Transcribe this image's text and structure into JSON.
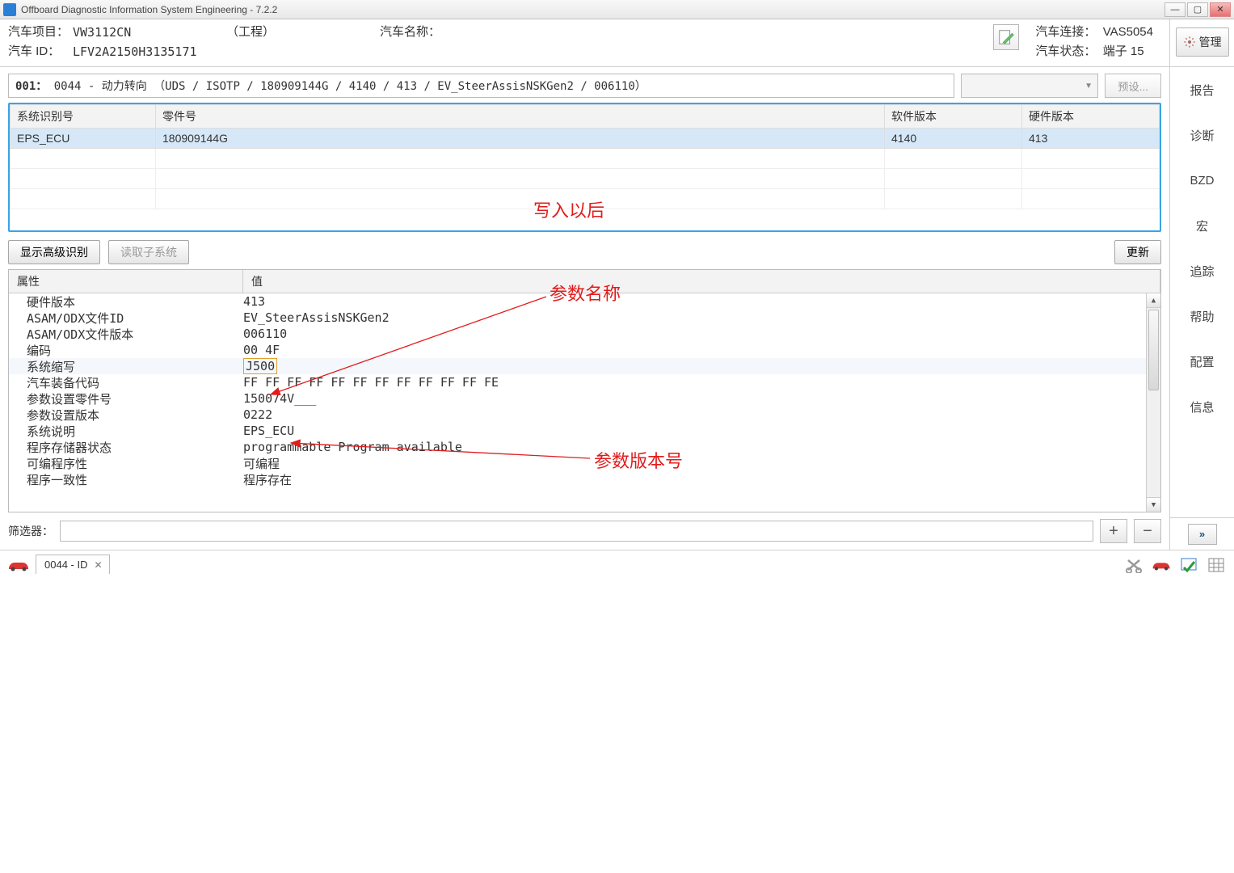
{
  "window": {
    "title": "Offboard Diagnostic Information System Engineering - 7.2.2"
  },
  "header": {
    "proj_lbl": "汽车项目：",
    "proj_val": "VW3112CN",
    "proj_note": "（工程）",
    "name_lbl": "汽车名称：",
    "id_lbl": "汽车 ID：",
    "id_val": "LFV2A2150H3135171",
    "conn_lbl": "汽车连接：",
    "conn_val": "VAS5054",
    "state_lbl": "汽车状态：",
    "state_val": "端子 15",
    "manage": "管理"
  },
  "path": {
    "prefix": "001：",
    "text": "0044 - 动力转向  （UDS / ISOTP / 180909144G / 4140 / 413 / EV_SteerAssisNSKGen2 / 006110）",
    "preset": "预设..."
  },
  "table1": {
    "cols": [
      "系统识别号",
      "零件号",
      "软件版本",
      "硬件版本"
    ],
    "row": {
      "sys": "EPS_ECU",
      "part": "180909144G",
      "sw": "4140",
      "hw": "413"
    }
  },
  "buttons": {
    "show_adv": "显示高级识别",
    "read_sub": "读取子系统",
    "update": "更新"
  },
  "props": {
    "head_attr": "属性",
    "head_val": "值",
    "rows": [
      {
        "a": "硬件版本",
        "v": "413"
      },
      {
        "a": "ASAM/ODX文件ID",
        "v": "EV_SteerAssisNSKGen2"
      },
      {
        "a": "ASAM/ODX文件版本",
        "v": "006110"
      },
      {
        "a": "编码",
        "v": "00 4F"
      },
      {
        "a": "系统缩写",
        "v": "J500",
        "boxed": true,
        "hl": true
      },
      {
        "a": "汽车装备代码",
        "v": "FF FF FF FF FF FF FF FF FF FF FF FE"
      },
      {
        "a": "参数设置零件号",
        "v": "150074V___"
      },
      {
        "a": "参数设置版本",
        "v": "0222"
      },
      {
        "a": "系统说明",
        "v": "EPS_ECU"
      },
      {
        "a": "程序存储器状态",
        "v": "programmable Program available"
      },
      {
        "a": "可编程序性",
        "v": "可编程"
      },
      {
        "a": "程序一致性",
        "v": "程序存在"
      }
    ]
  },
  "filter_label": "筛选器：",
  "side_items": [
    "报告",
    "诊断",
    "BZD",
    "宏",
    "追踪",
    "帮助",
    "配置",
    "信息"
  ],
  "bottom": {
    "tab_label": "0044 - ID"
  },
  "annotations": {
    "after_write": "写入以后",
    "param_name": "参数名称",
    "param_ver": "参数版本号"
  }
}
